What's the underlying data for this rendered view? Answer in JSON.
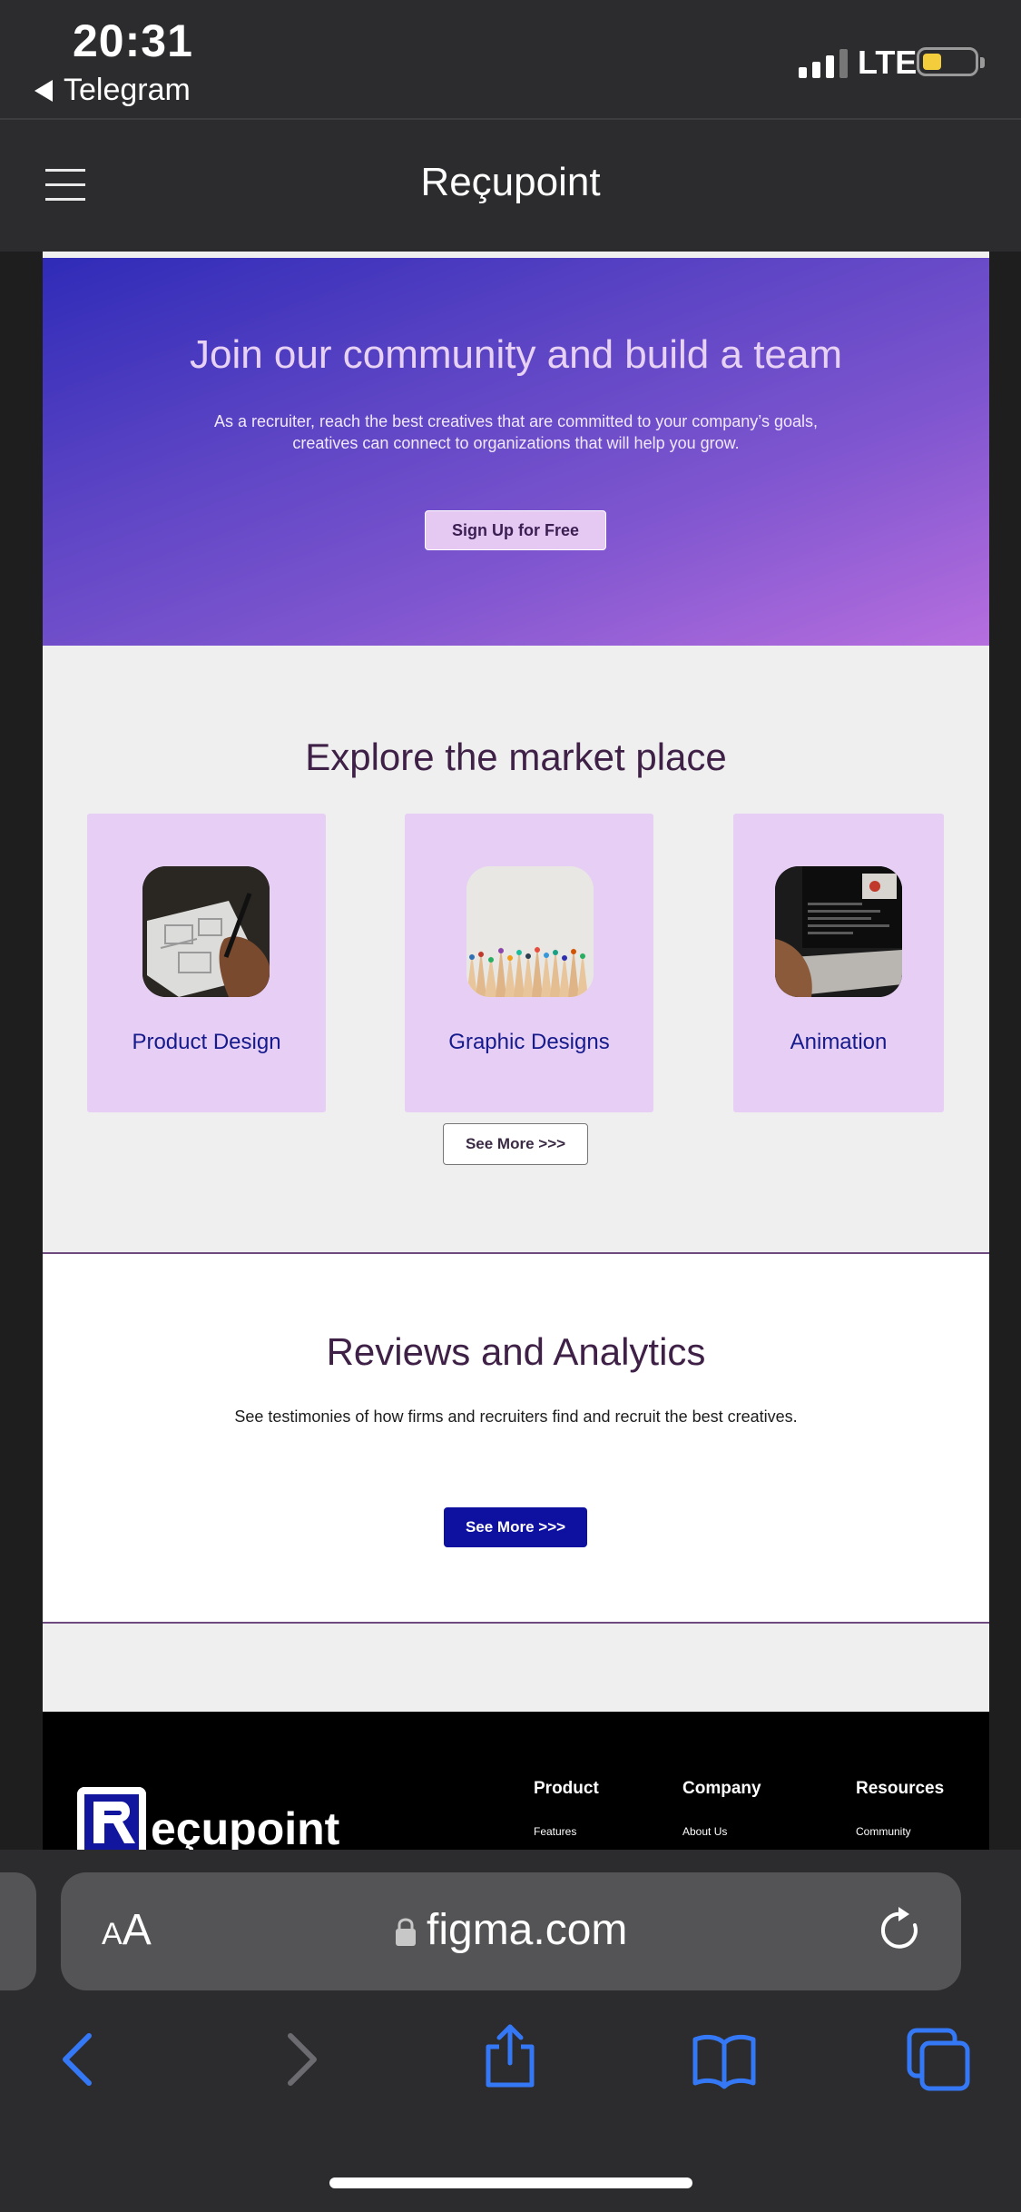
{
  "status": {
    "time": "20:31",
    "back_app": "Telegram",
    "network": "LTE"
  },
  "app": {
    "title": "Reçupoint"
  },
  "hero": {
    "title": "Join our community and build a team",
    "subtitle": "As a recruiter, reach the best creatives that are committed to your company’s goals, creatives can connect to organizations that will help you grow.",
    "button": "Sign Up for Free"
  },
  "explore": {
    "title": "Explore the market place",
    "cards": [
      {
        "label": "Product Design"
      },
      {
        "label": "Graphic Designs"
      },
      {
        "label": "Animation"
      }
    ],
    "see_more": "See More >>>"
  },
  "reviews": {
    "title": "Reviews and Analytics",
    "subtitle": "See testimonies of how firms and recruiters find and recruit the best creatives.",
    "see_more": "See More >>>"
  },
  "footer": {
    "brand": "eçupoint",
    "columns": [
      {
        "heading": "Product",
        "item": "Features"
      },
      {
        "heading": "Company",
        "item": "About Us"
      },
      {
        "heading": "Resources",
        "item": "Community"
      }
    ]
  },
  "browser": {
    "aa_small": "A",
    "aa_big": "A",
    "url": "figma.com"
  },
  "colors": {
    "accent": "#0e11a0",
    "card": "#e6cef4",
    "heading": "#3f2147",
    "ios_blue": "#3478f6"
  }
}
